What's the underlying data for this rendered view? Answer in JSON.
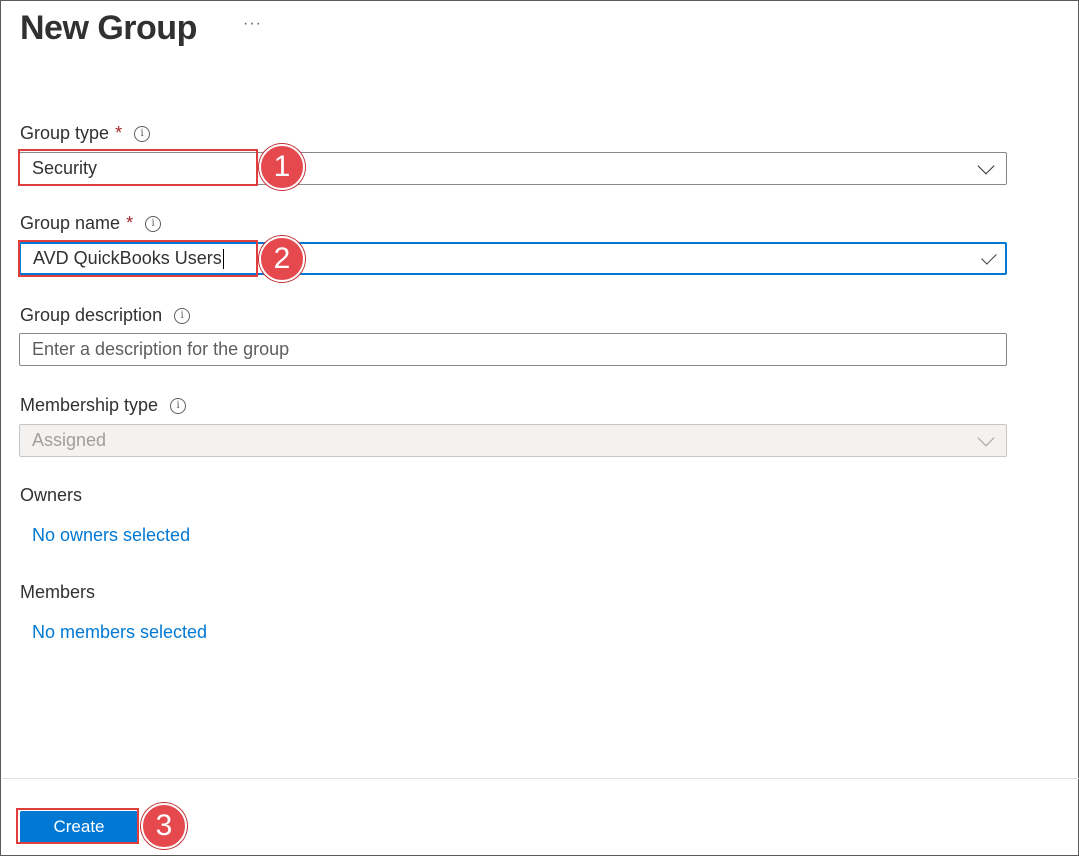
{
  "page": {
    "title": "New Group",
    "more_label": "···"
  },
  "form": {
    "group_type": {
      "label": "Group type",
      "required_mark": "*",
      "value": "Security"
    },
    "group_name": {
      "label": "Group name",
      "required_mark": "*",
      "value": "AVD QuickBooks Users"
    },
    "group_description": {
      "label": "Group description",
      "placeholder": "Enter a description for the group"
    },
    "membership_type": {
      "label": "Membership type",
      "value": "Assigned"
    },
    "owners": {
      "label": "Owners",
      "link": "No owners selected"
    },
    "members": {
      "label": "Members",
      "link": "No members selected"
    }
  },
  "footer": {
    "create_label": "Create"
  },
  "annotations": {
    "step1": "1",
    "step2": "2",
    "step3": "3"
  },
  "colors": {
    "accent": "#0078d4",
    "required": "#a4262c",
    "annotation": "#e5484d"
  },
  "icons": {
    "info": "info-icon",
    "dropdown": "chevron-down-icon",
    "valid": "checkmark-icon",
    "more": "more-icon"
  }
}
